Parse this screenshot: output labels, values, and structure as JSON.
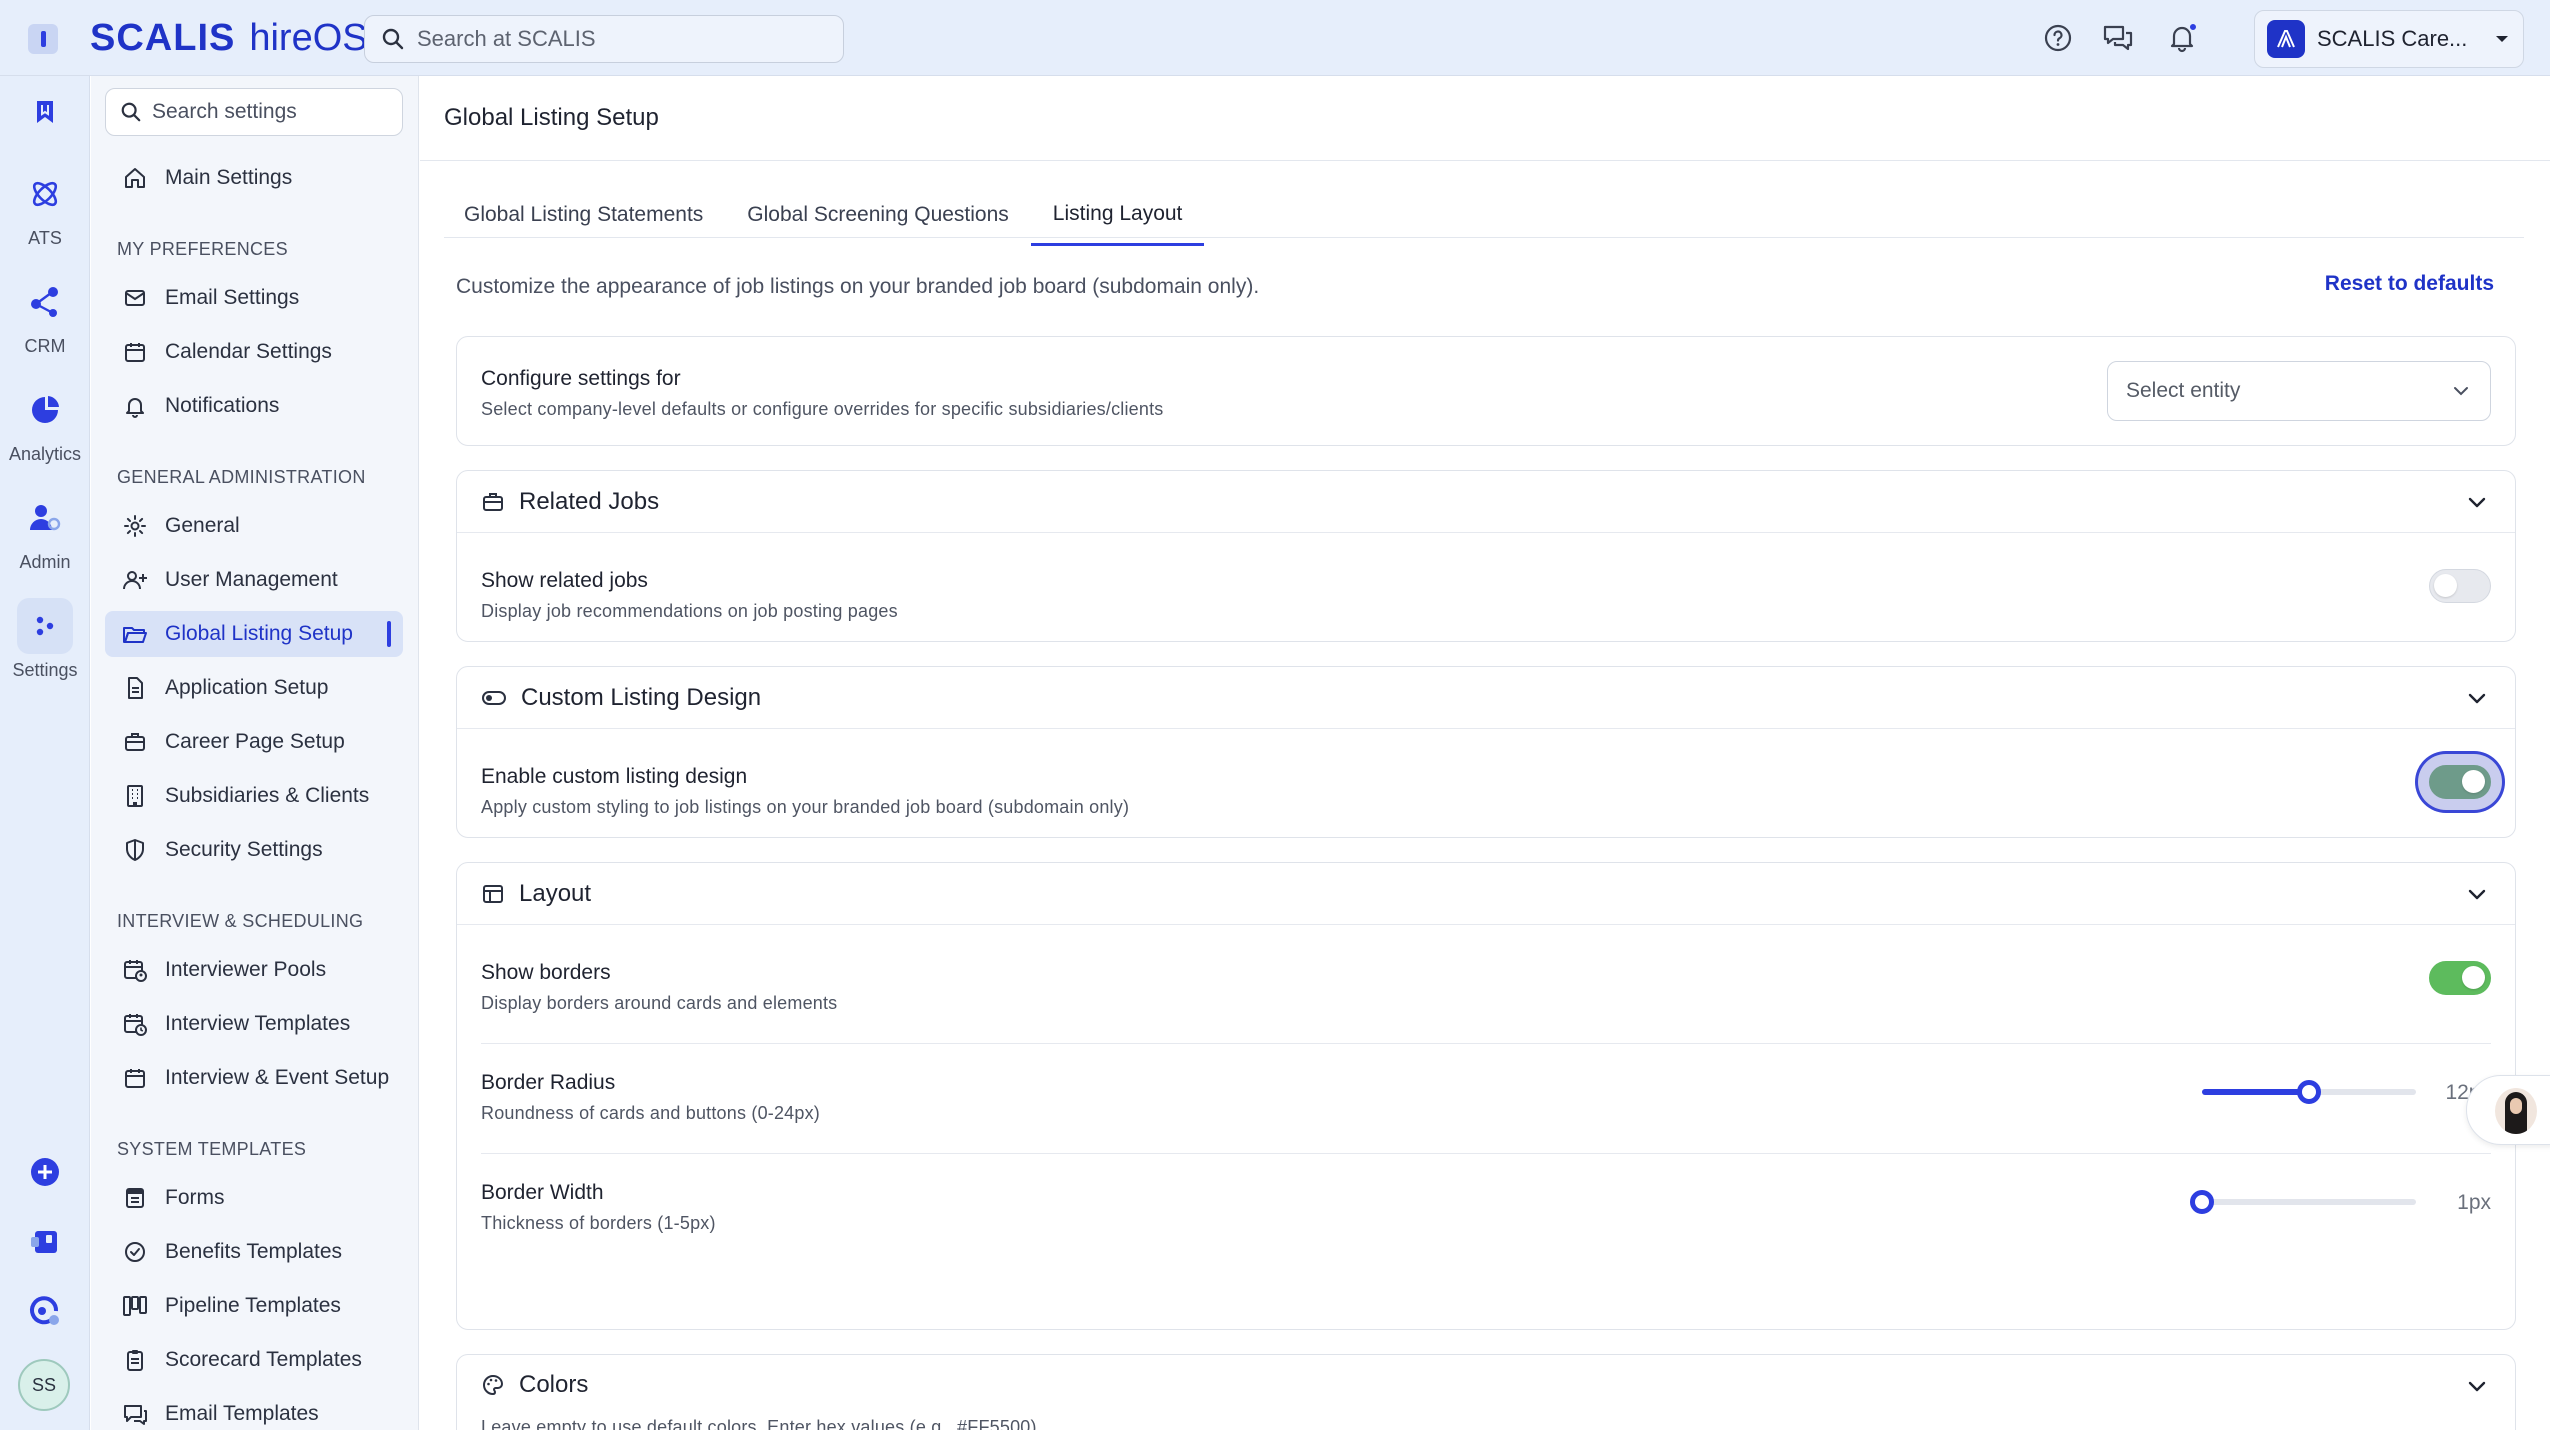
{
  "brand": {
    "name": "SCALIS",
    "product": "hireOS"
  },
  "top_search": {
    "placeholder": "Search at SCALIS"
  },
  "org": {
    "name": "SCALIS Care..."
  },
  "rail": {
    "items": [
      {
        "label": ""
      },
      {
        "label": "ATS"
      },
      {
        "label": "CRM"
      },
      {
        "label": "Analytics"
      },
      {
        "label": "Admin"
      },
      {
        "label": "Settings"
      }
    ],
    "avatar_initials": "SS"
  },
  "sidebar": {
    "search_placeholder": "Search settings",
    "main_settings": "Main Settings",
    "sections": {
      "preferences": "MY PREFERENCES",
      "general_admin": "GENERAL ADMINISTRATION",
      "interview": "INTERVIEW & SCHEDULING",
      "system_templates": "SYSTEM TEMPLATES"
    },
    "items": {
      "email_settings": "Email Settings",
      "calendar_settings": "Calendar Settings",
      "notifications": "Notifications",
      "general": "General",
      "user_management": "User Management",
      "global_listing_setup": "Global Listing Setup",
      "application_setup": "Application Setup",
      "career_page_setup": "Career Page Setup",
      "subsidiaries_clients": "Subsidiaries & Clients",
      "security_settings": "Security Settings",
      "interviewer_pools": "Interviewer Pools",
      "interview_templates": "Interview Templates",
      "interview_event_setup": "Interview & Event Setup",
      "forms": "Forms",
      "benefits_templates": "Benefits Templates",
      "pipeline_templates": "Pipeline Templates",
      "scorecard_templates": "Scorecard Templates",
      "email_templates": "Email Templates"
    }
  },
  "main": {
    "title": "Global Listing Setup",
    "tabs": [
      "Global Listing Statements",
      "Global Screening Questions",
      "Listing Layout"
    ],
    "active_tab": 2,
    "description": "Customize the appearance of job listings on your branded job board (subdomain only).",
    "reset_label": "Reset to defaults",
    "configure": {
      "title": "Configure settings for",
      "subtitle": "Select company-level defaults or configure overrides for specific subsidiaries/clients",
      "select_placeholder": "Select entity"
    },
    "related_jobs": {
      "title": "Related Jobs",
      "row_title": "Show related jobs",
      "row_sub": "Display job recommendations on job posting pages",
      "enabled": false
    },
    "custom_design": {
      "title": "Custom Listing Design",
      "row_title": "Enable custom listing design",
      "row_sub": "Apply custom styling to job listings on your branded job board (subdomain only)",
      "enabled": true
    },
    "layout": {
      "title": "Layout",
      "show_borders": {
        "title": "Show borders",
        "sub": "Display borders around cards and elements",
        "enabled": true
      },
      "border_radius": {
        "title": "Border Radius",
        "sub": "Roundness of cards and buttons (0-24px)",
        "value_label": "12px",
        "value": 12,
        "min": 0,
        "max": 24
      },
      "border_width": {
        "title": "Border Width",
        "sub": "Thickness of borders (1-5px)",
        "value_label": "1px",
        "value": 1,
        "min": 1,
        "max": 5
      }
    },
    "colors": {
      "title": "Colors",
      "sub": "Leave empty to use default colors. Enter hex values (e.g., #FF5500)."
    }
  },
  "theme": {
    "accent": "#2d3ee0",
    "toggle_on": "#5dbb5d"
  }
}
